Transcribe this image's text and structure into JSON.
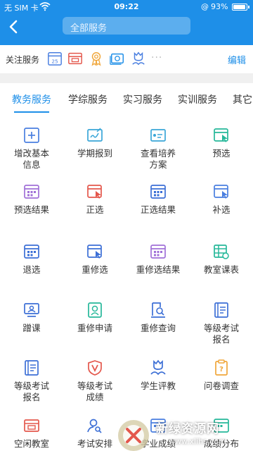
{
  "status_bar": {
    "carrier": "无 SIM 卡",
    "time": "09:22",
    "battery_percent_text": "93%",
    "battery_level": 0.93
  },
  "header": {
    "back_icon": "chevron-left-icon",
    "search_placeholder": "全部服务"
  },
  "follow": {
    "label": "关注服务",
    "items": [
      {
        "icon": "calendar-25-icon",
        "color": "#4a7fe0",
        "day": "25"
      },
      {
        "icon": "box-icon",
        "color": "#e4574c"
      },
      {
        "icon": "award-icon",
        "color": "#f0a63a"
      },
      {
        "icon": "money-icon",
        "color": "#1e8fe8"
      },
      {
        "icon": "tulip-icon",
        "color": "#4a7fe0"
      }
    ],
    "more": "···",
    "edit_label": "编辑"
  },
  "tabs": [
    {
      "label": "教务服务",
      "active": true
    },
    {
      "label": "学综服务",
      "active": false
    },
    {
      "label": "实习服务",
      "active": false
    },
    {
      "label": "实训服务",
      "active": false
    },
    {
      "label": "其它",
      "active": false
    }
  ],
  "services": [
    {
      "label": "增改基本\n信息",
      "icon": "plus-square-icon",
      "color": "#4a7fe0"
    },
    {
      "label": "学期报到",
      "icon": "signature-icon",
      "color": "#3aa6d8"
    },
    {
      "label": "查看培养\n方案",
      "icon": "plan-icon",
      "color": "#3aa6d8"
    },
    {
      "label": "预选",
      "icon": "calendar-touch-icon",
      "color": "#26b89a"
    },
    {
      "label": "预选结果",
      "icon": "calendar-grid-icon",
      "color": "#a071d8"
    },
    {
      "label": "正选",
      "icon": "calendar-touch-icon",
      "color": "#e4574c"
    },
    {
      "label": "正选结果",
      "icon": "calendar-grid-icon",
      "color": "#3c6fd6"
    },
    {
      "label": "补选",
      "icon": "calendar-touch-icon",
      "color": "#4a7fe0"
    },
    {
      "label": "退选",
      "icon": "calendar-grid-icon",
      "color": "#3c6fd6"
    },
    {
      "label": "重修选",
      "icon": "calendar-touch-icon",
      "color": "#3c6fd6"
    },
    {
      "label": "重修选结果",
      "icon": "calendar-grid-icon",
      "color": "#a071d8"
    },
    {
      "label": "教室课表",
      "icon": "timetable-icon",
      "color": "#26b89a"
    },
    {
      "label": "蹭课",
      "icon": "monitor-person-icon",
      "color": "#3c6fd6"
    },
    {
      "label": "重修申请",
      "icon": "portrait-icon",
      "color": "#26b89a"
    },
    {
      "label": "重修查询",
      "icon": "doc-search-icon",
      "color": "#3c6fd6"
    },
    {
      "label": "等级考试\n报名",
      "icon": "notebook-icon",
      "color": "#3c6fd6"
    },
    {
      "label": "等级考试\n报名",
      "icon": "notebook-icon",
      "color": "#3c6fd6"
    },
    {
      "label": "等级考试\n成绩",
      "icon": "shield-v-icon",
      "color": "#e4574c"
    },
    {
      "label": "学生评教",
      "icon": "tulip-icon",
      "color": "#3c6fd6"
    },
    {
      "label": "问卷调查",
      "icon": "questionnaire-icon",
      "color": "#f0a63a"
    },
    {
      "label": "空闲教室",
      "icon": "box-icon",
      "color": "#e4574c"
    },
    {
      "label": "考试安排",
      "icon": "person-search-icon",
      "color": "#3c6fd6"
    },
    {
      "label": "学业成绩",
      "icon": "calendar-grid-icon",
      "color": "#4a7fe0"
    },
    {
      "label": "成绩分布",
      "icon": "calendar-grid-icon",
      "color": "#26b89a"
    }
  ],
  "watermark": {
    "text": "新绿资源网",
    "url": "www.xlihs.com"
  }
}
